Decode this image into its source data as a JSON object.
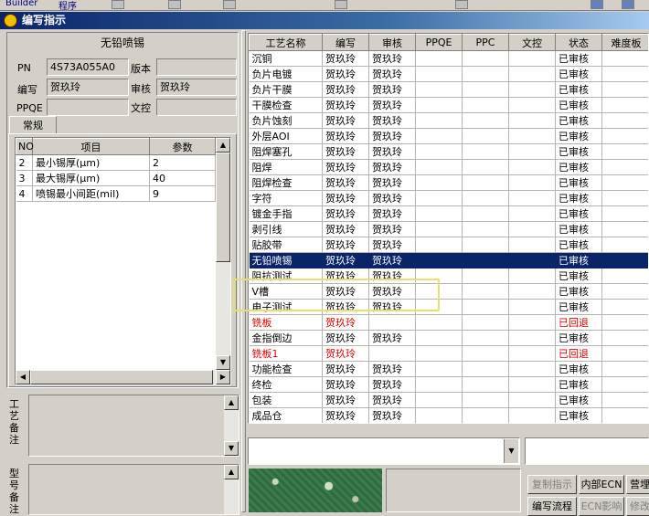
{
  "top_strip": {
    "items": [
      "Builder",
      "程序"
    ]
  },
  "title_bar": {
    "title": "编写指示"
  },
  "left": {
    "section_title": "无铅喷锡",
    "pn_label": "PN",
    "pn_value": "4S73A055A0",
    "version_label": "版本",
    "version_value": "",
    "author_label": "编写",
    "author_value": "贺玖玲",
    "reviewer_label": "审核",
    "reviewer_value": "贺玖玲",
    "ppqe_label": "PPQE",
    "ppqe_value": "",
    "doc_label": "文控",
    "doc_value": "",
    "tab_label": "常规",
    "param_headers": [
      "NO",
      "项目",
      "参数"
    ],
    "params": [
      {
        "no": "2",
        "item": "最小锡厚(μm)",
        "value": "2"
      },
      {
        "no": "3",
        "item": "最大锡厚(μm)",
        "value": "40"
      },
      {
        "no": "4",
        "item": "喷锡最小间距(mil)",
        "value": "9"
      }
    ],
    "process_note_label": "工艺备注",
    "model_note_label": "型号备注"
  },
  "grid": {
    "headers": [
      "工艺名称",
      "编写",
      "审核",
      "PPQE",
      "PPC",
      "文控",
      "状态",
      "难度板"
    ],
    "rows": [
      {
        "name": "沉铜",
        "author": "贺玖玲",
        "reviewer": "贺玖玲",
        "status": "已审核"
      },
      {
        "name": "负片电镀",
        "author": "贺玖玲",
        "reviewer": "贺玖玲",
        "status": "已审核"
      },
      {
        "name": "负片干膜",
        "author": "贺玖玲",
        "reviewer": "贺玖玲",
        "status": "已审核"
      },
      {
        "name": "干膜检查",
        "author": "贺玖玲",
        "reviewer": "贺玖玲",
        "status": "已审核"
      },
      {
        "name": "负片蚀刻",
        "author": "贺玖玲",
        "reviewer": "贺玖玲",
        "status": "已审核"
      },
      {
        "name": "外层AOI",
        "author": "贺玖玲",
        "reviewer": "贺玖玲",
        "status": "已审核"
      },
      {
        "name": "阻焊塞孔",
        "author": "贺玖玲",
        "reviewer": "贺玖玲",
        "status": "已审核"
      },
      {
        "name": "阻焊",
        "author": "贺玖玲",
        "reviewer": "贺玖玲",
        "status": "已审核"
      },
      {
        "name": "阻焊检查",
        "author": "贺玖玲",
        "reviewer": "贺玖玲",
        "status": "已审核"
      },
      {
        "name": "字符",
        "author": "贺玖玲",
        "reviewer": "贺玖玲",
        "status": "已审核"
      },
      {
        "name": "镀金手指",
        "author": "贺玖玲",
        "reviewer": "贺玖玲",
        "status": "已审核"
      },
      {
        "name": "剥引线",
        "author": "贺玖玲",
        "reviewer": "贺玖玲",
        "status": "已审核"
      },
      {
        "name": "贴胶带",
        "author": "贺玖玲",
        "reviewer": "贺玖玲",
        "status": "已审核"
      },
      {
        "name": "无铅喷锡",
        "author": "贺玖玲",
        "reviewer": "贺玖玲",
        "status": "已审核",
        "selected": true
      },
      {
        "name": "阻抗测试",
        "author": "贺玖玲",
        "reviewer": "贺玖玲",
        "status": "已审核"
      },
      {
        "name": "V槽",
        "author": "贺玖玲",
        "reviewer": "贺玖玲",
        "status": "已审核"
      },
      {
        "name": "电子测试",
        "author": "贺玖玲",
        "reviewer": "贺玖玲",
        "status": "已审核"
      },
      {
        "name": "铣板",
        "author": "贺玖玲",
        "reviewer": "",
        "status": "已回退",
        "returned": true
      },
      {
        "name": "金指倒边",
        "author": "贺玖玲",
        "reviewer": "贺玖玲",
        "status": "已审核"
      },
      {
        "name": "铣板1",
        "author": "贺玖玲",
        "reviewer": "",
        "status": "已回退",
        "returned": true
      },
      {
        "name": "功能检查",
        "author": "贺玖玲",
        "reviewer": "贺玖玲",
        "status": "已审核"
      },
      {
        "name": "终检",
        "author": "贺玖玲",
        "reviewer": "贺玖玲",
        "status": "已审核"
      },
      {
        "name": "包装",
        "author": "贺玖玲",
        "reviewer": "贺玖玲",
        "status": "已审核"
      },
      {
        "name": "成品仓",
        "author": "贺玖玲",
        "reviewer": "贺玖玲",
        "status": "已审核"
      }
    ]
  },
  "buttons": {
    "copy": "复制指示",
    "internal_ecn": "内部ECN",
    "extra": "营埋",
    "edit_flow": "编写流程",
    "ecn_effect": "ECN影响",
    "modify": "修改"
  },
  "colors": {
    "selection": "#0a246a",
    "returned": "#e00000",
    "highlight_box": "#e6e070"
  }
}
